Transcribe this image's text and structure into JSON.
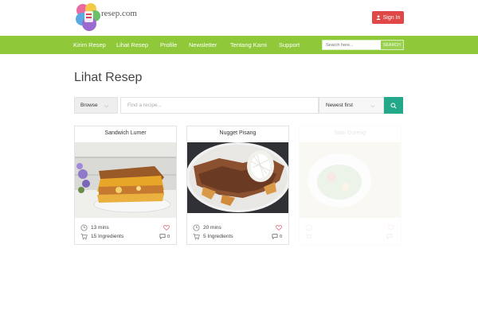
{
  "brand": {
    "name": "resep.com"
  },
  "header": {
    "signin_label": "Sign In"
  },
  "nav": {
    "items": [
      "Kirim Resep",
      "Lihat Resep",
      "Profile",
      "Newsletter",
      "Tentang Kami",
      "Support"
    ],
    "search_placeholder": "Search here...",
    "search_button": "SEARCH"
  },
  "page": {
    "title": "Lihat Resep"
  },
  "filters": {
    "browse_label": "Browse",
    "find_placeholder": "Find a recipe...",
    "sort_label": "Newest first"
  },
  "recipes": [
    {
      "title": "Sandwich Lumer",
      "time": "13 mins",
      "ingredients": "15 Ingredients",
      "comments": "0"
    },
    {
      "title": "Nugget Pisang",
      "time": "20 mins",
      "ingredients": "5 Ingredients",
      "comments": "0"
    },
    {
      "title": "Nasi Goreng",
      "time": "",
      "ingredients": "",
      "comments": ""
    }
  ],
  "colors": {
    "nav_green": "#8fc93a",
    "signin_red": "#e04848",
    "search_teal": "#23a98a",
    "heart_pink": "#e05a6a"
  },
  "icons": [
    "user-icon",
    "chevron-down-icon",
    "search-icon",
    "clock-icon",
    "cart-icon",
    "heart-icon",
    "comment-icon"
  ]
}
